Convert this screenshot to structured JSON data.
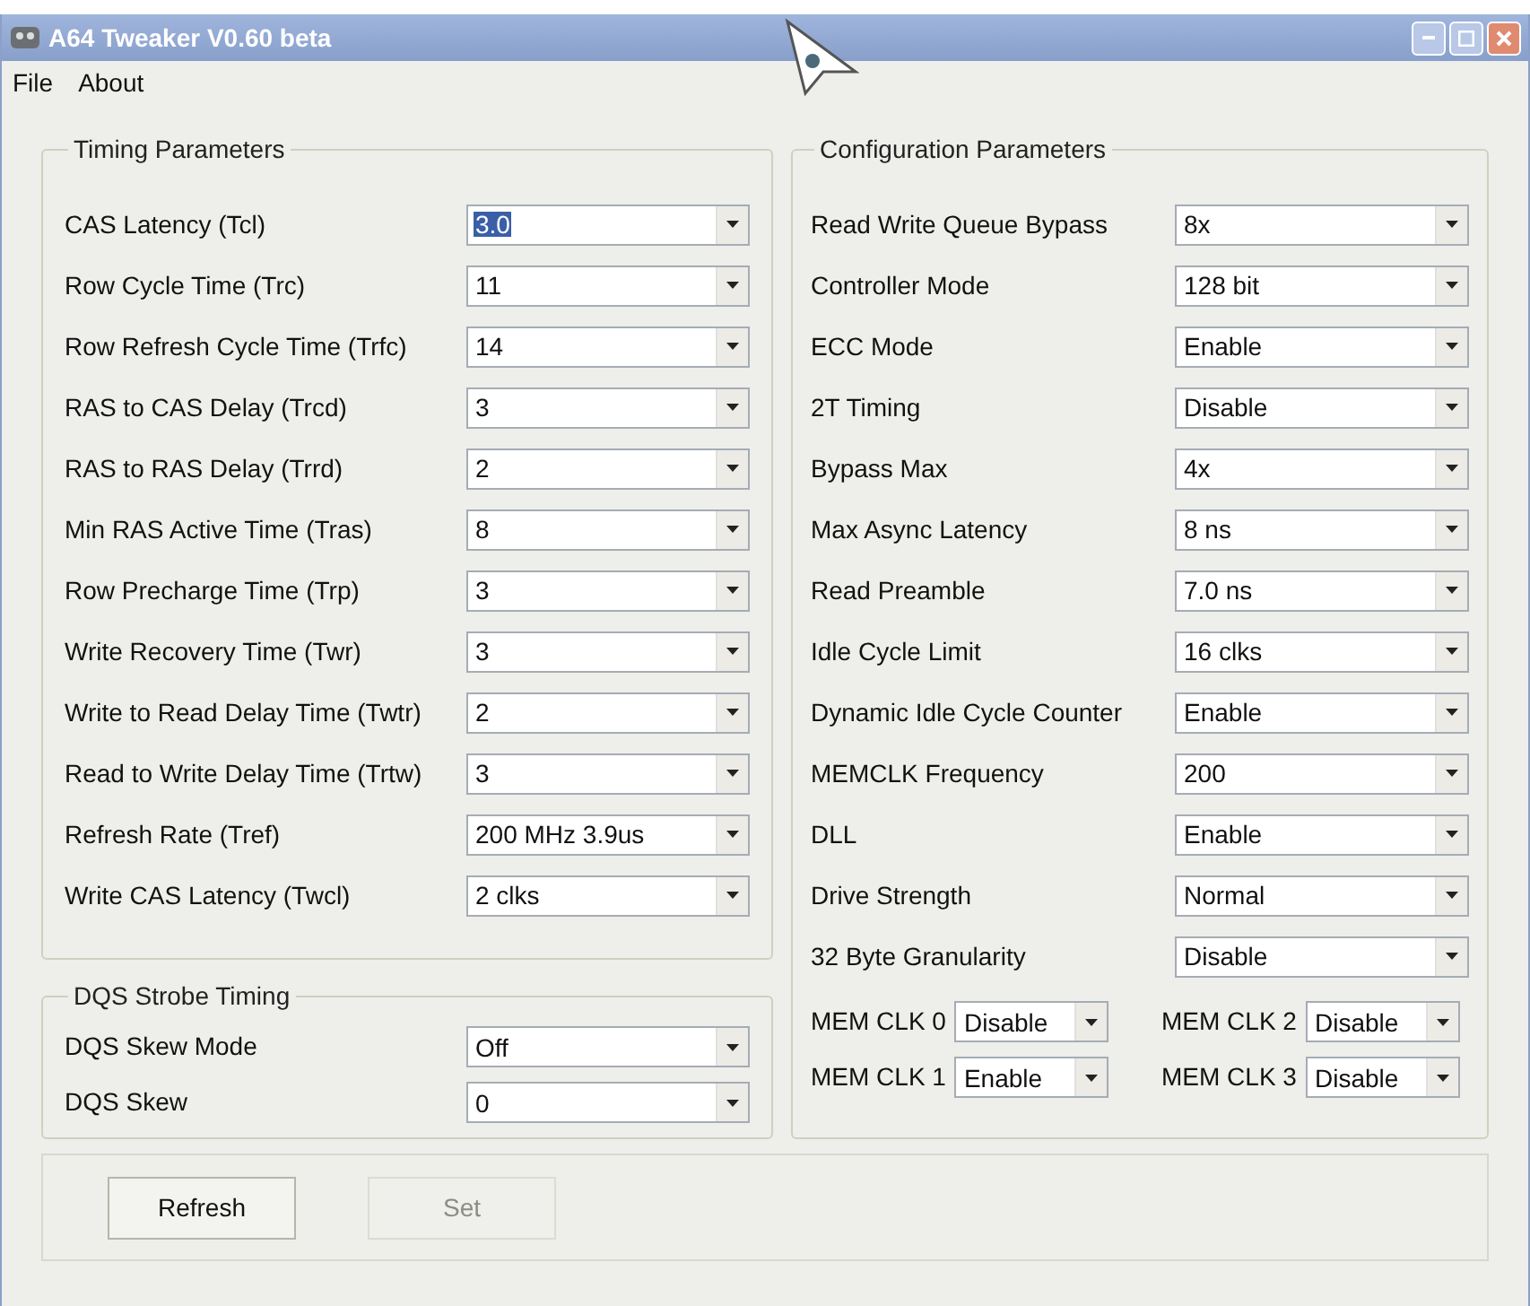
{
  "window": {
    "title": "A64 Tweaker V0.60 beta"
  },
  "menu": [
    "File",
    "About"
  ],
  "timing": {
    "title": "Timing Parameters",
    "rows": [
      {
        "label": "CAS Latency (Tcl)",
        "value": "3.0",
        "highlighted": true
      },
      {
        "label": "Row Cycle Time (Trc)",
        "value": "11",
        "highlighted": false
      },
      {
        "label": "Row Refresh Cycle Time (Trfc)",
        "value": "14",
        "highlighted": false
      },
      {
        "label": "RAS to CAS Delay (Trcd)",
        "value": "3",
        "highlighted": false
      },
      {
        "label": "RAS to RAS Delay (Trrd)",
        "value": "2",
        "highlighted": false
      },
      {
        "label": "Min RAS Active Time (Tras)",
        "value": "8",
        "highlighted": false
      },
      {
        "label": "Row Precharge Time (Trp)",
        "value": "3",
        "highlighted": false
      },
      {
        "label": "Write Recovery Time (Twr)",
        "value": "3",
        "highlighted": false
      },
      {
        "label": "Write to Read Delay Time (Twtr)",
        "value": "2",
        "highlighted": false
      },
      {
        "label": "Read to Write Delay Time (Trtw)",
        "value": "3",
        "highlighted": false
      },
      {
        "label": "Refresh Rate (Tref)",
        "value": "200 MHz 3.9us",
        "highlighted": false
      },
      {
        "label": "Write CAS Latency (Twcl)",
        "value": "2 clks",
        "highlighted": false
      }
    ]
  },
  "dqs": {
    "title": "DQS Strobe Timing",
    "rows": [
      {
        "label": "DQS Skew Mode",
        "value": "Off"
      },
      {
        "label": "DQS Skew",
        "value": "0"
      }
    ]
  },
  "config": {
    "title": "Configuration Parameters",
    "rows": [
      {
        "label": "Read Write Queue Bypass",
        "value": "8x"
      },
      {
        "label": "Controller Mode",
        "value": "128 bit"
      },
      {
        "label": "ECC Mode",
        "value": "Enable"
      },
      {
        "label": "2T Timing",
        "value": "Disable"
      },
      {
        "label": "Bypass Max",
        "value": "4x"
      },
      {
        "label": "Max Async Latency",
        "value": "8 ns"
      },
      {
        "label": "Read Preamble",
        "value": "7.0 ns"
      },
      {
        "label": "Idle Cycle Limit",
        "value": "16 clks"
      },
      {
        "label": "Dynamic Idle Cycle Counter",
        "value": "Enable"
      },
      {
        "label": "MEMCLK Frequency",
        "value": "200"
      },
      {
        "label": "DLL",
        "value": "Enable"
      },
      {
        "label": "Drive Strength",
        "value": "Normal"
      },
      {
        "label": "32 Byte Granularity",
        "value": "Disable"
      }
    ],
    "memclk": [
      {
        "label": "MEM CLK 0",
        "value": "Disable"
      },
      {
        "label": "MEM CLK 2",
        "value": "Disable"
      },
      {
        "label": "MEM CLK 1",
        "value": "Enable"
      },
      {
        "label": "MEM CLK 3",
        "value": "Disable"
      }
    ]
  },
  "buttons": [
    {
      "label": "Refresh",
      "disabled": false
    },
    {
      "label": "Set",
      "disabled": true
    }
  ]
}
